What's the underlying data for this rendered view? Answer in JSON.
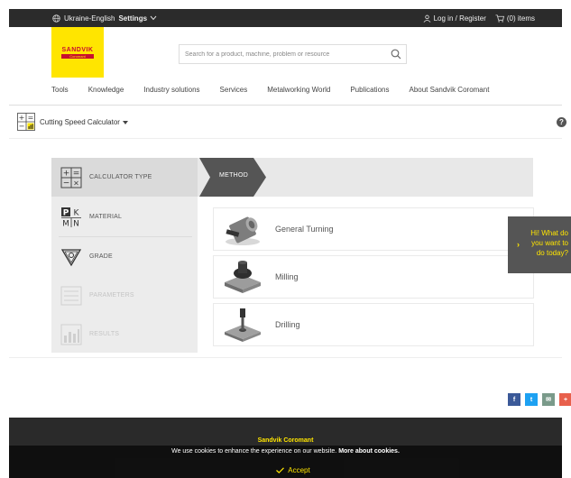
{
  "topbar": {
    "region": "Ukraine-English",
    "settings": "Settings",
    "login": "Log in / Register",
    "cart": "(0) items"
  },
  "brand": {
    "logo_text": "SANDVIK",
    "logo_sub": "Coromant",
    "brand_color": "#ffe500",
    "logo_red": "#c8102e"
  },
  "search": {
    "placeholder": "Search for a product, machine, problem or resource"
  },
  "nav": [
    "Tools",
    "Knowledge",
    "Industry solutions",
    "Services",
    "Metalworking World",
    "Publications",
    "About Sandvik Coromant"
  ],
  "tool": {
    "title": "Cutting Speed Calculator",
    "help": "?"
  },
  "steps": [
    {
      "label": "CALCULATOR TYPE",
      "icon": "calculator-icon",
      "state": "active"
    },
    {
      "label": "MATERIAL",
      "icon": "pkmn-material-icon",
      "state": "normal"
    },
    {
      "label": "GRADE",
      "icon": "grade-insert-icon",
      "state": "normal"
    },
    {
      "label": "PARAMETERS",
      "icon": "parameters-icon",
      "state": "disabled"
    },
    {
      "label": "RESULTS",
      "icon": "results-chart-icon",
      "state": "disabled"
    }
  ],
  "method": {
    "label": "METHOD"
  },
  "options": [
    {
      "name": "General Turning",
      "icon": "turning-icon"
    },
    {
      "name": "Milling",
      "icon": "milling-icon"
    },
    {
      "name": "Drilling",
      "icon": "drilling-icon"
    }
  ],
  "chat": {
    "text": "Hi! What do you want to do today?"
  },
  "share": [
    {
      "label": "f",
      "icon": "facebook-icon",
      "color": "#3b5998"
    },
    {
      "label": "t",
      "icon": "twitter-icon",
      "color": "#1da1f2"
    },
    {
      "label": "✉",
      "icon": "email-icon",
      "color": "#7a9a8a"
    },
    {
      "label": "+",
      "icon": "plus-share-icon",
      "color": "#e8604c"
    }
  ],
  "footer": {
    "brand": "Sandvik Coromant"
  },
  "cookie": {
    "message": "We use cookies to enhance the experience on our website.",
    "link": "More about cookies.",
    "accept": "Accept"
  }
}
